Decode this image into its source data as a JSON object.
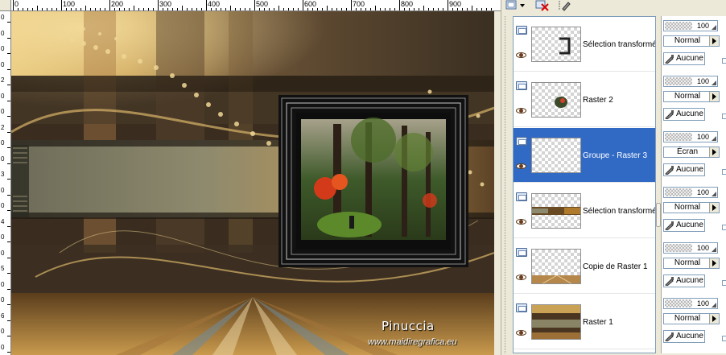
{
  "ruler_top_labels": [
    "0",
    "100",
    "200",
    "300",
    "400",
    "500",
    "600",
    "700",
    "800",
    "900"
  ],
  "ruler_left_labels": [
    "0",
    "0",
    "0",
    "0",
    "2",
    "0",
    "0",
    "2",
    "0",
    "0",
    "3",
    "0",
    "0",
    "4",
    "0",
    "0",
    "5",
    "0",
    "0",
    "6",
    "0",
    "0"
  ],
  "watermark": {
    "name": "Pinuccia",
    "url": "www.maidiregrafica.eu"
  },
  "toolbar": {
    "new_layer_icon": "new-raster-layer-icon",
    "delete_icon": "delete-layer-icon",
    "edit_icon": "edit-layer-icon"
  },
  "layers": [
    {
      "name": "Sélection transformée",
      "opacity": "100",
      "blend": "Normal",
      "mask": "Aucune",
      "selected": false
    },
    {
      "name": "Raster 2",
      "opacity": "100",
      "blend": "Normal",
      "mask": "Aucune",
      "selected": false
    },
    {
      "name": "Groupe - Raster 3",
      "opacity": "100",
      "blend": "Écran",
      "mask": "Aucune",
      "selected": true
    },
    {
      "name": "Sélection transformée",
      "opacity": "100",
      "blend": "Normal",
      "mask": "Aucune",
      "selected": false
    },
    {
      "name": "Copie de Raster 1",
      "opacity": "100",
      "blend": "Normal",
      "mask": "Aucune",
      "selected": false
    },
    {
      "name": "Raster 1",
      "opacity": "100",
      "blend": "Normal",
      "mask": "Aucune",
      "selected": false
    }
  ],
  "colors": {
    "selection": "#316ac5",
    "panel_bg": "#ece9d8",
    "canvas_gold": "#c9a24a",
    "canvas_dark": "#2c241a"
  }
}
